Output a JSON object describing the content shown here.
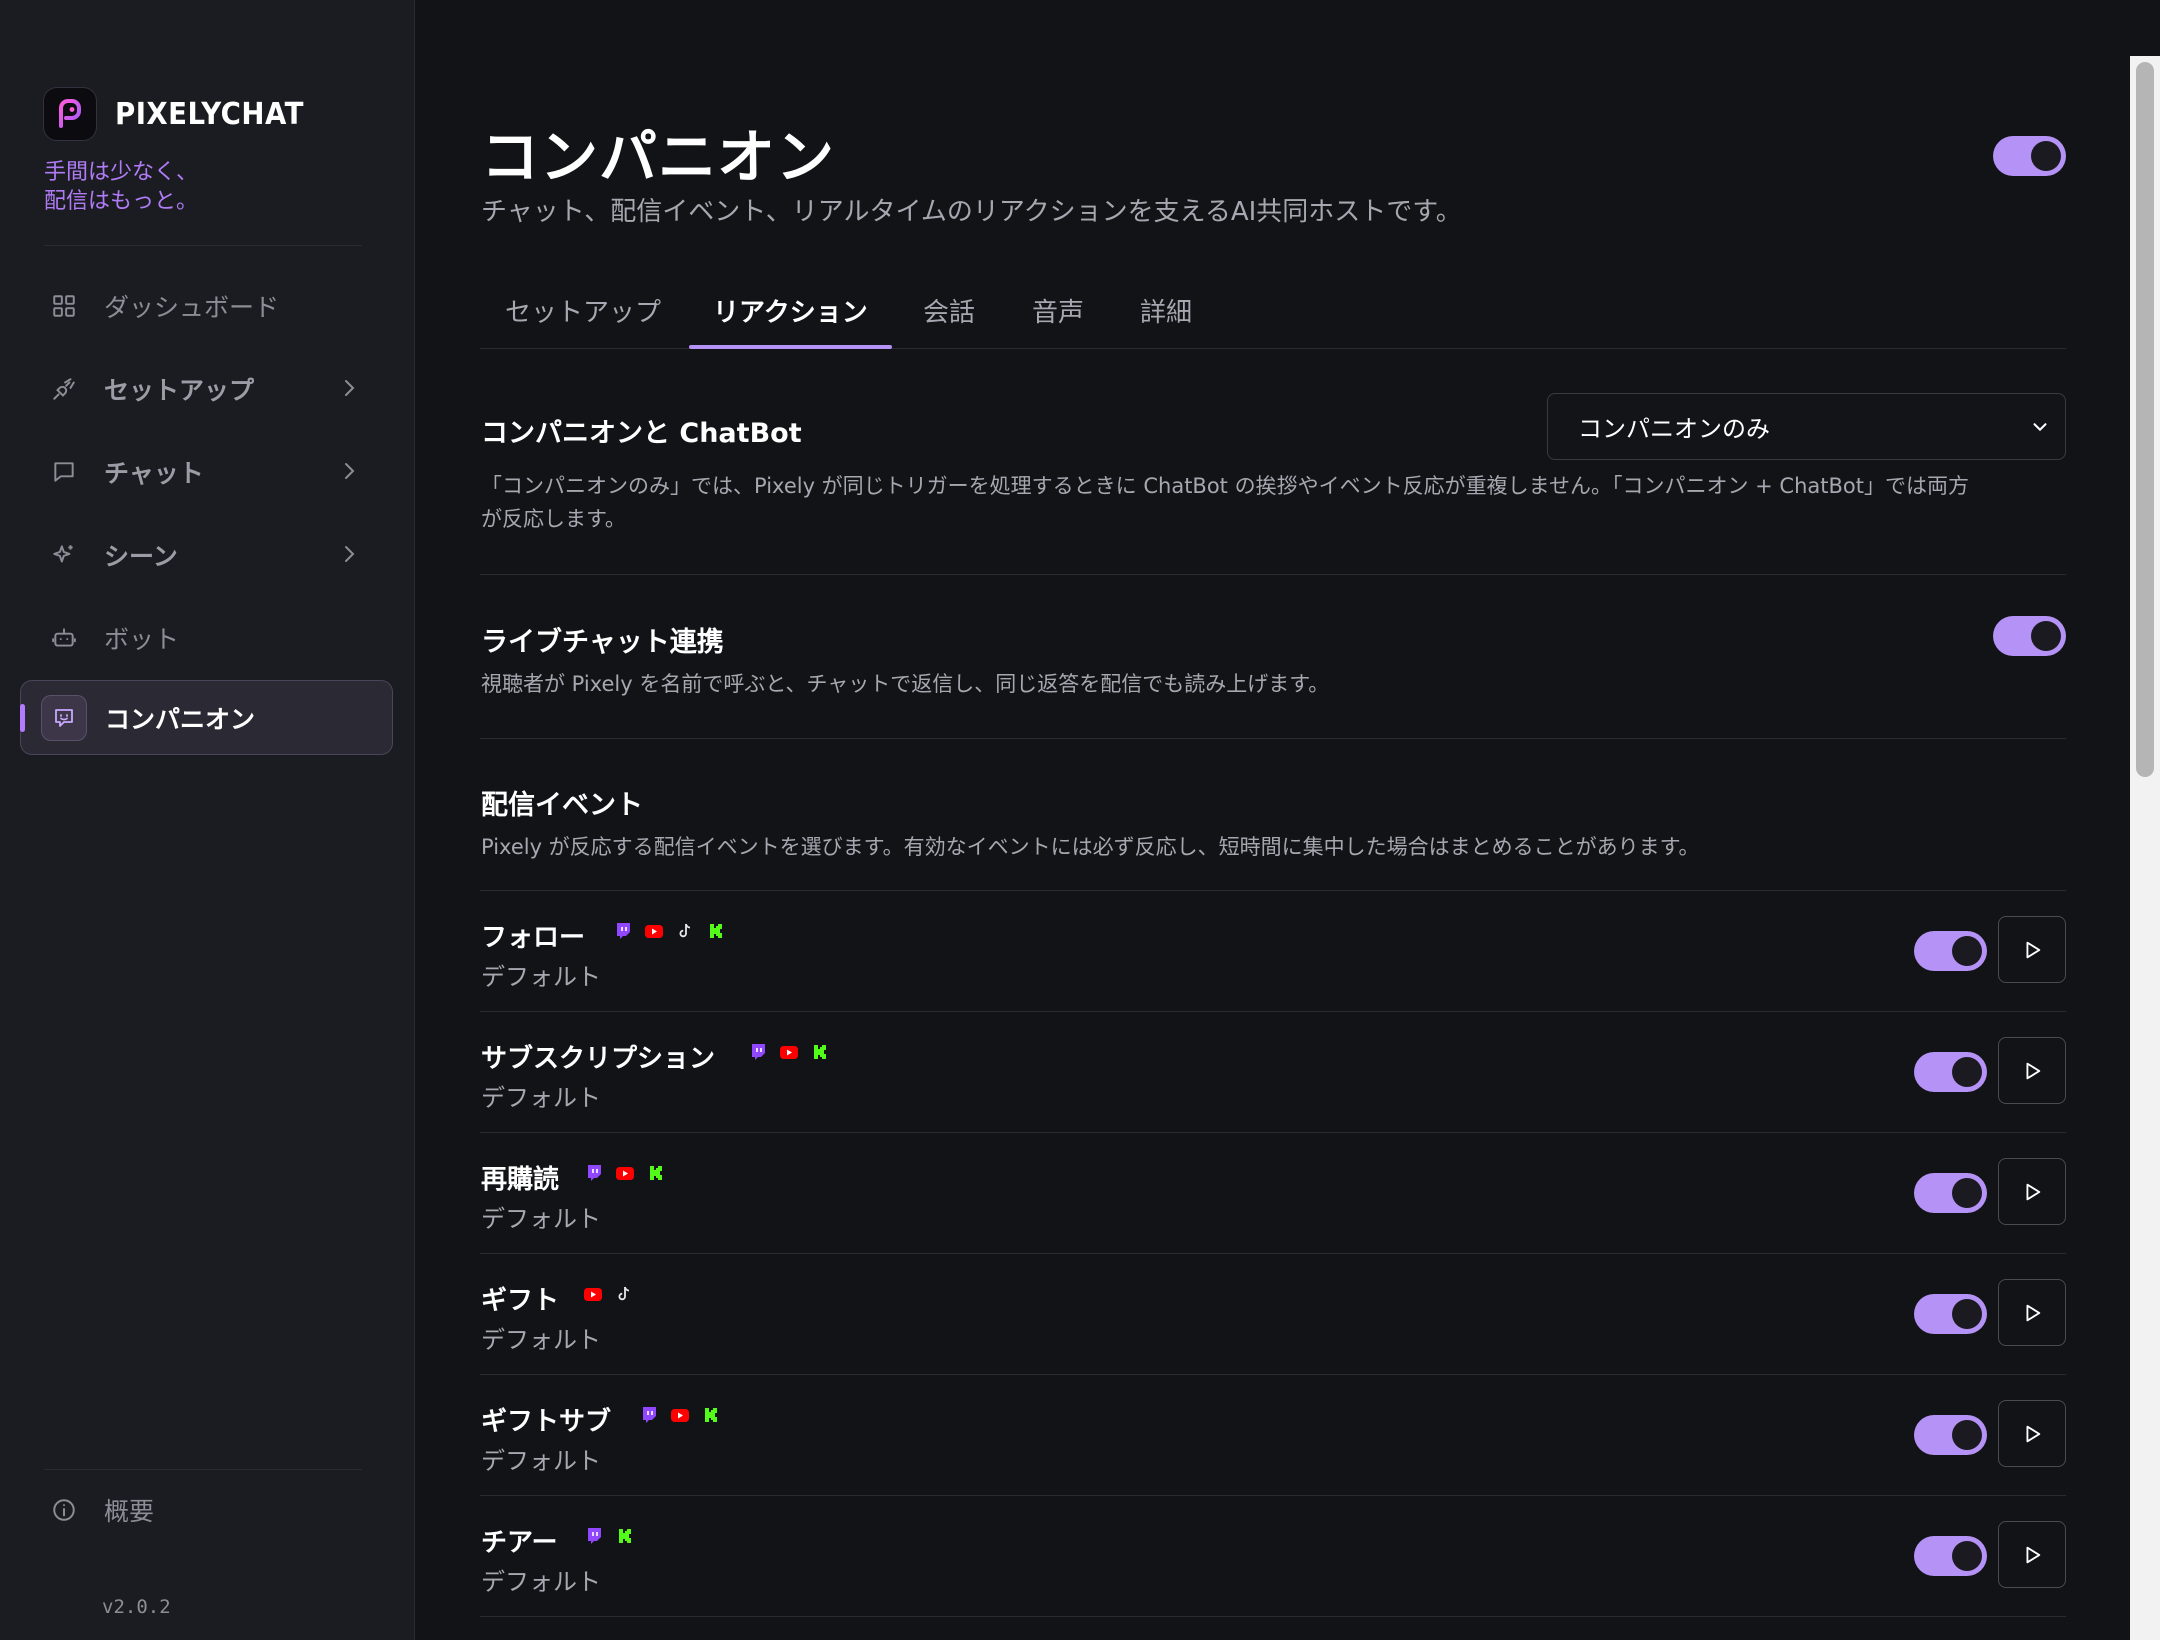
{
  "brand": {
    "name": "PIXELYCHAT",
    "tagline_1": "手間は少なく、",
    "tagline_2": "配信はもっと。"
  },
  "sidebar": {
    "items": [
      {
        "label": "ダッシュボード",
        "icon": "grid-icon"
      },
      {
        "label": "セットアップ",
        "icon": "plug-icon"
      },
      {
        "label": "チャット",
        "icon": "chat-bubble-icon"
      },
      {
        "label": "シーン",
        "icon": "sparkles-icon"
      },
      {
        "label": "ボット",
        "icon": "robot-icon"
      },
      {
        "label": "コンパニオン",
        "icon": "companion-icon"
      }
    ],
    "about": "概要",
    "version": "v2.0.2"
  },
  "header": {
    "title": "コンパニオン",
    "subtitle": "チャット、配信イベント、リアルタイムのリアクションを支えるAI共同ホストです。",
    "enabled": true
  },
  "tabs": [
    "セットアップ",
    "リアクション",
    "会話",
    "音声",
    "詳細"
  ],
  "active_tab": "リアクション",
  "chatbot_section": {
    "title": "コンパニオンと ChatBot",
    "select_value": "コンパニオンのみ",
    "desc_1": "「コンパニオンのみ」では、Pixely が同じトリガーを処理するときに ChatBot の挨拶やイベント反応が重複しません。「コンパニオン + ChatBot」では両方",
    "desc_2": "が反応します。"
  },
  "livechat_section": {
    "title": "ライブチャット連携",
    "desc": "視聴者が Pixely を名前で呼ぶと、チャットで返信し、同じ返答を配信でも読み上げます。",
    "enabled": true
  },
  "events_section": {
    "title": "配信イベント",
    "desc": "Pixely が反応する配信イベントを選びます。有効なイベントには必ず反応し、短時間に集中した場合はまとめることがあります。"
  },
  "events": [
    {
      "name": "フォロー",
      "sub": "デフォルト",
      "platforms": [
        "twitch",
        "youtube",
        "tiktok",
        "kick"
      ]
    },
    {
      "name": "サブスクリプション",
      "sub": "デフォルト",
      "platforms": [
        "twitch",
        "youtube",
        "kick"
      ]
    },
    {
      "name": "再購読",
      "sub": "デフォルト",
      "platforms": [
        "twitch",
        "youtube",
        "kick"
      ]
    },
    {
      "name": "ギフト",
      "sub": "デフォルト",
      "platforms": [
        "youtube",
        "tiktok"
      ]
    },
    {
      "name": "ギフトサブ",
      "sub": "デフォルト",
      "platforms": [
        "twitch",
        "youtube",
        "kick"
      ]
    },
    {
      "name": "チアー",
      "sub": "デフォルト",
      "platforms": [
        "twitch",
        "kick"
      ]
    }
  ],
  "colors": {
    "accent": "#b592f5",
    "background": "#121316",
    "sidebar": "#1b1c21",
    "twitch": "#9146ff",
    "youtube": "#ff0000",
    "kick": "#53fc18"
  }
}
